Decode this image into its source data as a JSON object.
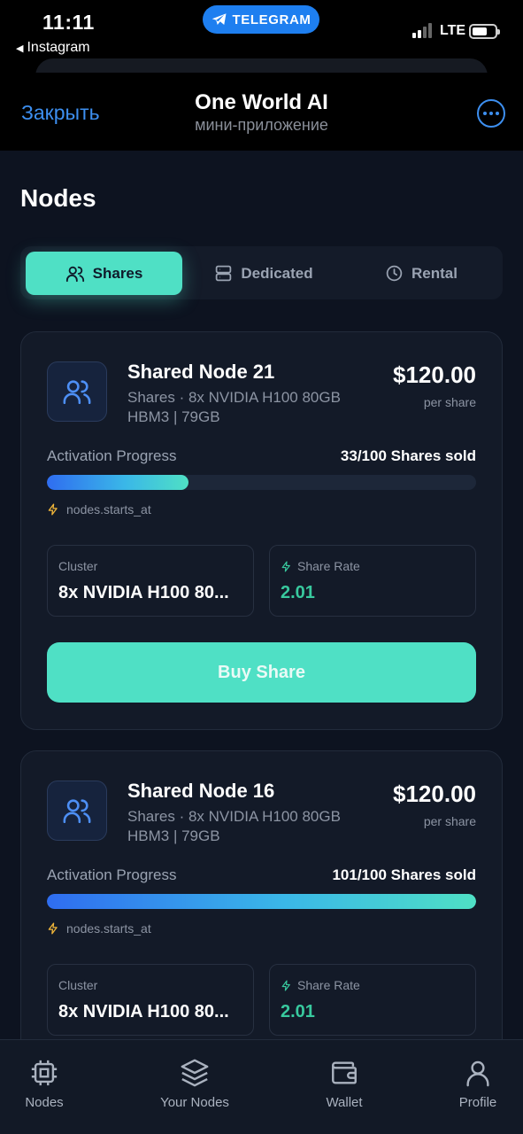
{
  "status_bar": {
    "time": "11:11",
    "back_app": "Instagram",
    "telegram_pill": "TELEGRAM",
    "network": "LTE"
  },
  "telegram": {
    "close_label": "Закрыть",
    "app_title": "One World AI",
    "app_subtitle": "мини-приложение",
    "more_icon": "more-dots-icon"
  },
  "page": {
    "title": "Nodes"
  },
  "tabs": [
    {
      "label": "Shares",
      "icon": "users-icon",
      "active": true
    },
    {
      "label": "Dedicated",
      "icon": "server-icon",
      "active": false
    },
    {
      "label": "Rental",
      "icon": "clock-icon",
      "active": false
    }
  ],
  "nodes": [
    {
      "name": "Shared Node 21",
      "spec": "Shares · 8x NVIDIA H100 80GB HBM3 | 79GB",
      "price": "$120.00",
      "price_unit": "per share",
      "progress_label": "Activation Progress",
      "sold_text": "33/100 Shares sold",
      "progress_fraction": 0.33,
      "starts_at": "nodes.starts_at",
      "cluster_label": "Cluster",
      "cluster_value": "8x NVIDIA H100 80...",
      "share_rate_label": "Share Rate",
      "share_rate_value": "2.01",
      "buy_label": "Buy Share"
    },
    {
      "name": "Shared Node 16",
      "spec": "Shares · 8x NVIDIA H100 80GB HBM3 | 79GB",
      "price": "$120.00",
      "price_unit": "per share",
      "progress_label": "Activation Progress",
      "sold_text": "101/100 Shares sold",
      "progress_fraction": 1.0,
      "starts_at": "nodes.starts_at",
      "cluster_label": "Cluster",
      "cluster_value": "8x NVIDIA H100 80...",
      "share_rate_label": "Share Rate",
      "share_rate_value": "2.01"
    }
  ],
  "bottom_nav": [
    {
      "label": "Nodes",
      "icon": "chip-icon"
    },
    {
      "label": "Your Nodes",
      "icon": "layers-icon"
    },
    {
      "label": "Wallet",
      "icon": "wallet-icon"
    },
    {
      "label": "Profile",
      "icon": "user-icon"
    }
  ],
  "colors": {
    "accent": "#4fe0c5",
    "link_blue": "#3d8ff0",
    "background": "#0d1320",
    "card": "#131a28",
    "share_rate_green": "#38c99e"
  }
}
